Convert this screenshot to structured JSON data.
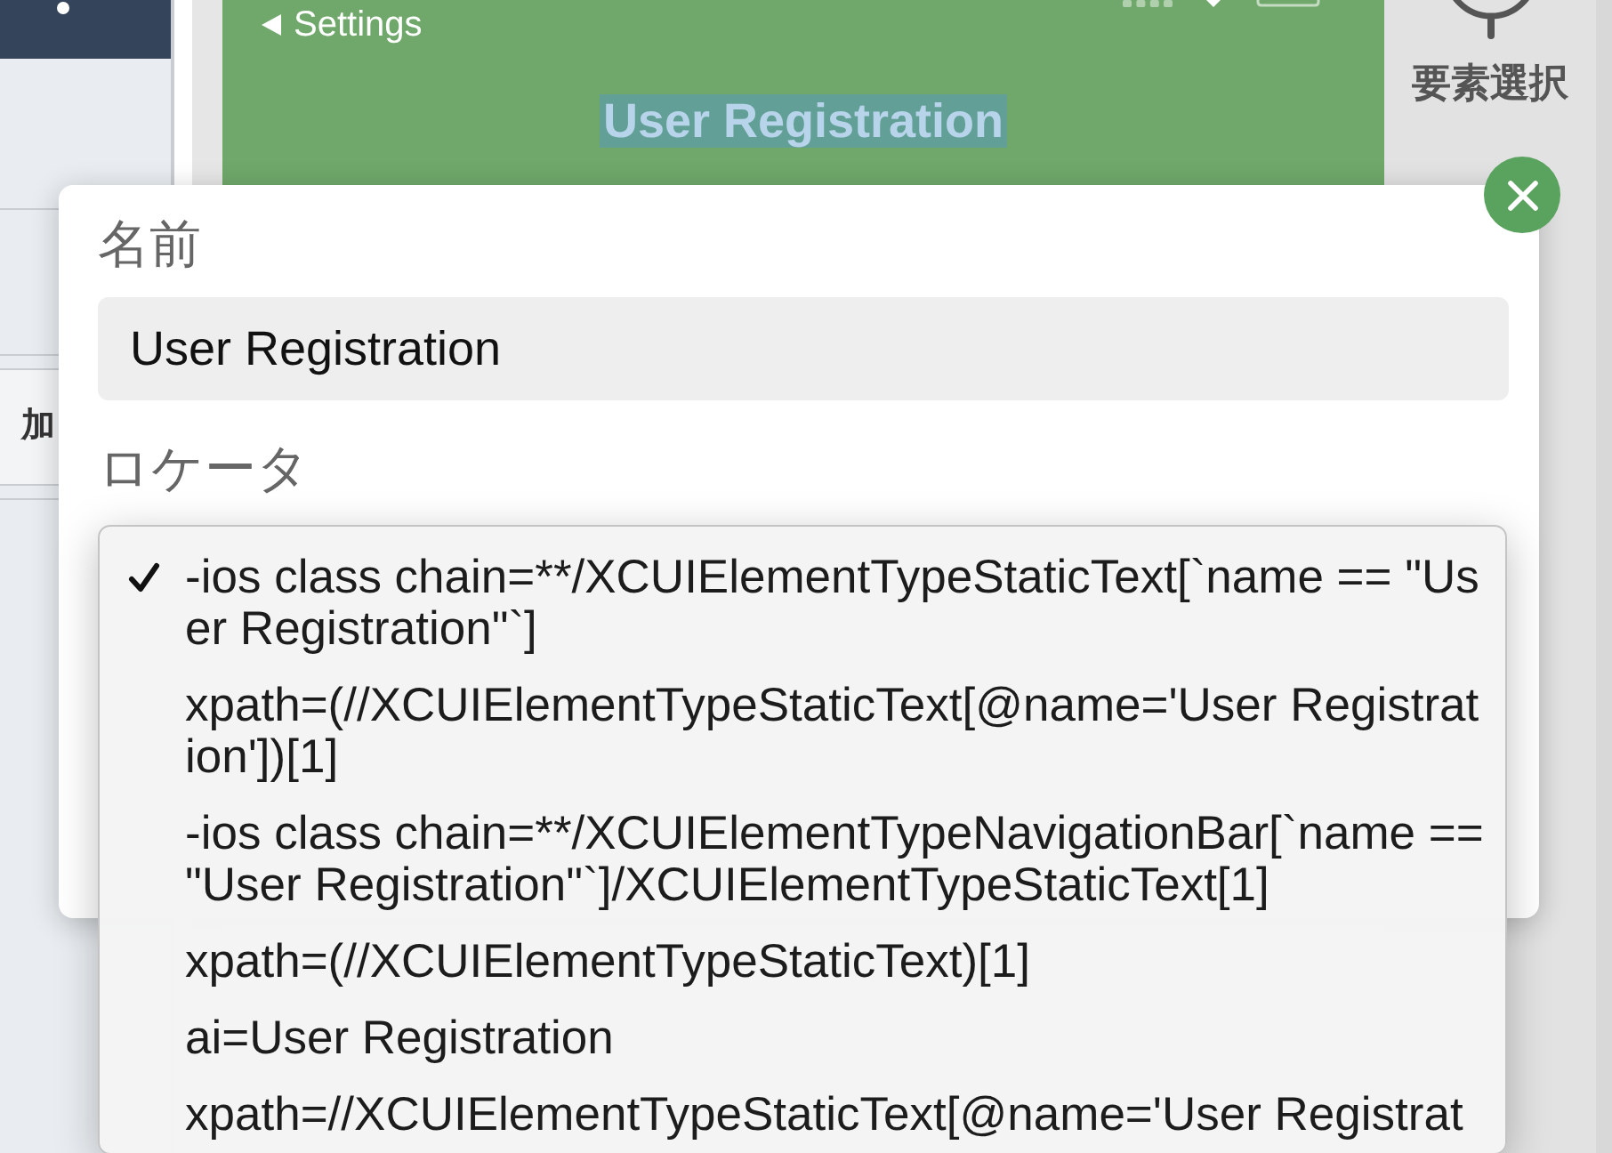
{
  "left_panel": {
    "button_label": "加"
  },
  "device_screen": {
    "back_label": "Settings",
    "title": {
      "text": "User Registration",
      "highlighted": true
    }
  },
  "toolbar": {
    "tool_label": "要素選択"
  },
  "dialog": {
    "name_label": "名前",
    "name_value": "User Registration",
    "locator_label": "ロケータ"
  },
  "locator_menu": {
    "items": [
      {
        "text": "-ios class chain=**/XCUIElementTypeStaticText[`name == \"User Registration\"`]",
        "selected": true
      },
      {
        "text": "xpath=(//XCUIElementTypeStaticText[@name='User Registration'])[1]",
        "selected": false
      },
      {
        "text": "-ios class chain=**/XCUIElementTypeNavigationBar[`name == \"User Registration\"`]/XCUIElementTypeStaticText[1]",
        "selected": false
      },
      {
        "text": "xpath=(//XCUIElementTypeStaticText)[1]",
        "selected": false
      },
      {
        "text": "ai=User Registration",
        "selected": false
      },
      {
        "text": "xpath=//XCUIElementTypeStaticText[@name='User Registrat",
        "selected": false
      }
    ]
  }
}
